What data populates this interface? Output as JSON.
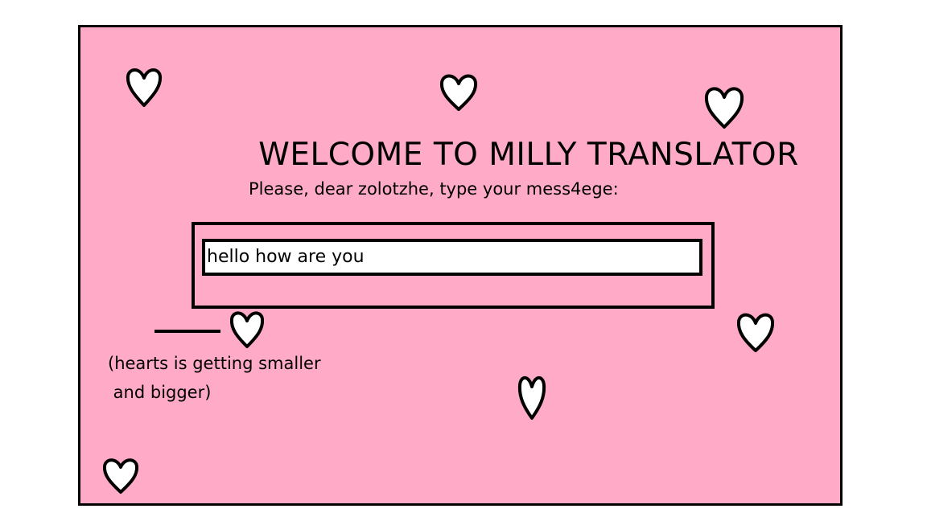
{
  "title": "WELCOME TO MILLY TRANSLATOR",
  "prompt": "Please, dear zolotzhe, type your mess4ege:",
  "input": {
    "value": "hello how are you"
  },
  "note": {
    "line1": "(hearts is getting smaller",
    "line2": " and bigger)"
  },
  "colors": {
    "card_background": "#ffabc8",
    "heart_fill": "#ffffff",
    "outline": "#000000"
  },
  "icons": {
    "decoration": "heart-icon"
  }
}
